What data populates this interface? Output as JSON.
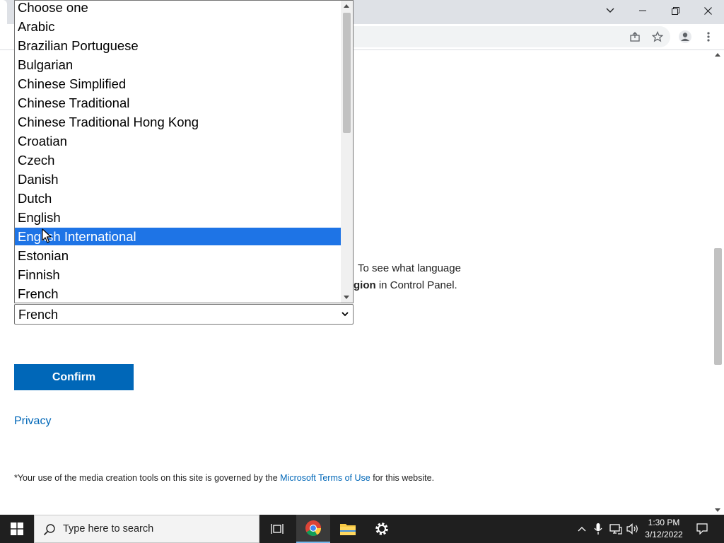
{
  "browser": {
    "window_controls": [
      "tab-search",
      "minimize",
      "restore",
      "close"
    ],
    "toolbar_icons": [
      "share-icon",
      "bookmark-star-icon",
      "profile-icon",
      "menu-icon"
    ]
  },
  "page": {
    "lang_text_line1": "To see what language",
    "lang_text_line2_bold": "gion",
    "lang_text_line2_rest": " in Control Panel.",
    "select_value": "French",
    "confirm_label": "Confirm",
    "privacy_label": "Privacy",
    "footnote_pre": "*Your use of the media creation tools on this site is governed by the ",
    "footnote_link": "Microsoft Terms of Use",
    "footnote_post": " for this website."
  },
  "dropdown": {
    "options": [
      "Choose one",
      "Arabic",
      "Brazilian Portuguese",
      "Bulgarian",
      "Chinese Simplified",
      "Chinese Traditional",
      "Chinese Traditional Hong Kong",
      "Croatian",
      "Czech",
      "Danish",
      "Dutch",
      "English",
      "English International",
      "Estonian",
      "Finnish",
      "French"
    ],
    "highlighted": "English International"
  },
  "taskbar": {
    "search_placeholder": "Type here to search",
    "time": "1:30 PM",
    "date": "3/12/2022",
    "apps": [
      "task-view-icon",
      "chrome-icon",
      "file-explorer-icon",
      "settings-icon"
    ]
  },
  "colors": {
    "accent": "#0067b8",
    "highlight": "#1e74e6",
    "taskbar": "#1f1f1f"
  }
}
